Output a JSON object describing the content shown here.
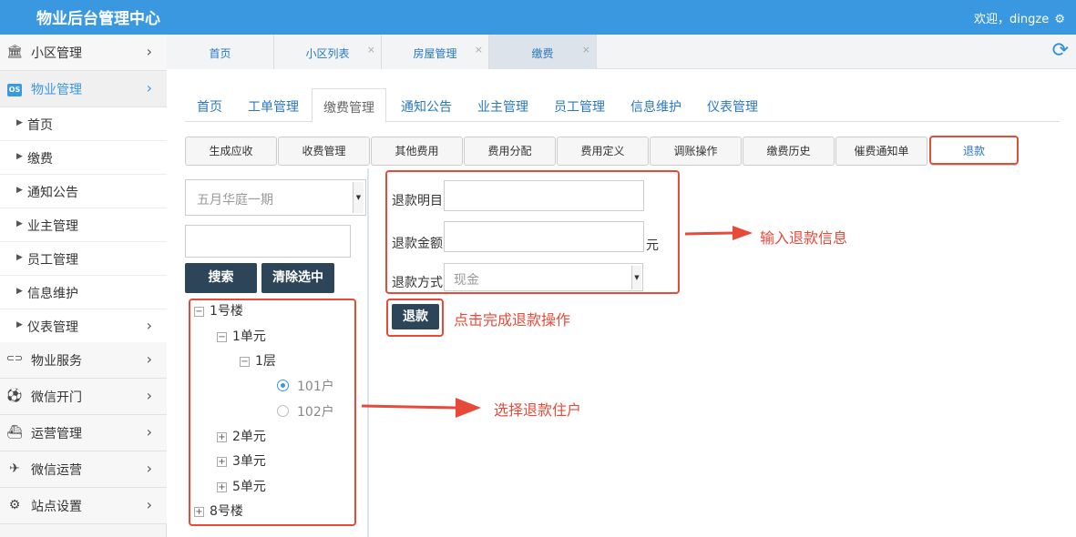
{
  "header": {
    "title": "物业后台管理中心",
    "welcome": "欢迎，dingze",
    "gear": "⚙"
  },
  "sidebar": {
    "groups": [
      {
        "label": "小区管理",
        "icon": "bank-icon",
        "glyph": "🏛"
      },
      {
        "label": "物业管理",
        "icon": "os-icon",
        "glyph": "OS"
      },
      {
        "label": "物业服务",
        "icon": "toggle-icon",
        "glyph": "⊂⊃"
      },
      {
        "label": "微信开门",
        "icon": "soccer-icon",
        "glyph": "⚽"
      },
      {
        "label": "运营管理",
        "icon": "ship-icon",
        "glyph": "⛴"
      },
      {
        "label": "微信运营",
        "icon": "paper-plane-icon",
        "glyph": "✈"
      },
      {
        "label": "站点设置",
        "icon": "cogs-icon",
        "glyph": "⚙"
      }
    ],
    "sub_items": [
      "首页",
      "缴费",
      "通知公告",
      "业主管理",
      "员工管理",
      "信息维护",
      "仪表管理"
    ],
    "chevron": "›",
    "triangle": "▶"
  },
  "tabstrip": {
    "tabs": [
      "首页",
      "小区列表",
      "房屋管理",
      "缴费"
    ],
    "close": "×",
    "refresh": "⟳"
  },
  "mainnav": [
    "首页",
    "工单管理",
    "缴费管理",
    "通知公告",
    "业主管理",
    "员工管理",
    "信息维护",
    "仪表管理"
  ],
  "subnav": [
    "生成应收",
    "收费管理",
    "其他费用",
    "费用分配",
    "费用定义",
    "调账操作",
    "缴费历史",
    "催费通知单",
    "退款"
  ],
  "left_panel": {
    "community_select": "五月华庭一期",
    "search_button": "搜索",
    "clear_button": "清除选中",
    "tree": {
      "building1": "1号楼",
      "unit1": "1单元",
      "floor1": "1层",
      "room101": "101户",
      "room102": "102户",
      "unit2": "2单元",
      "unit3": "3单元",
      "unit5": "5单元",
      "building8": "8号楼",
      "minus": "−",
      "plus": "+"
    }
  },
  "refund_form": {
    "detail_label": "退款明目",
    "amount_label": "退款金额",
    "amount_unit": "元",
    "method_label": "退款方式",
    "method_value": "现金",
    "submit": "退款"
  },
  "annotations": {
    "input_info": "输入退款信息",
    "click_complete": "点击完成退款操作",
    "select_household": "选择退款住户"
  },
  "colors": {
    "brand": "#3a98e0",
    "annotation": "#e84a3a",
    "dark_button": "#2d4558"
  }
}
